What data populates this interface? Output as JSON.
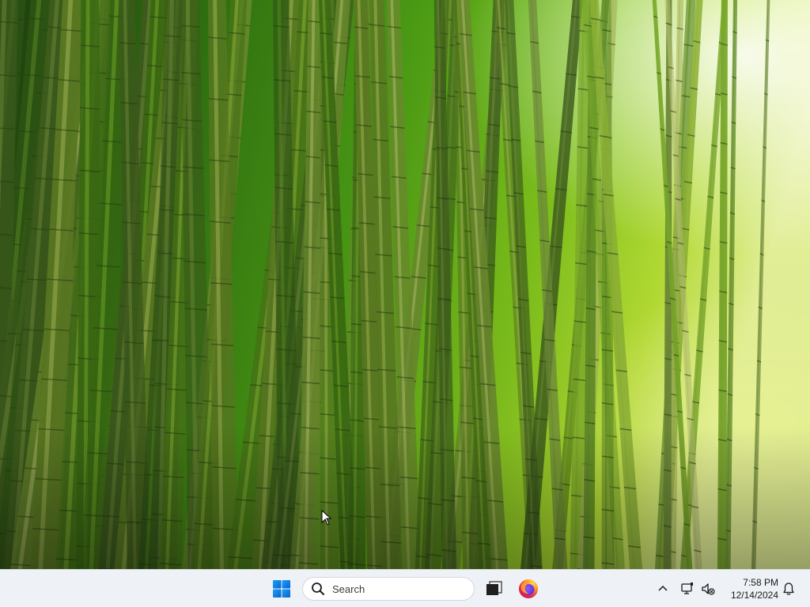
{
  "desktop": {
    "wallpaper_icon": "bamboo-forest-wallpaper"
  },
  "taskbar": {
    "start_icon": "windows-logo-icon",
    "search": {
      "placeholder": "Search",
      "icon": "search-icon"
    },
    "task_view_icon": "task-view-icon",
    "pinned_apps": [
      {
        "name": "Firefox",
        "icon": "firefox-icon"
      }
    ],
    "tray": {
      "chevron_icon": "chevron-up-icon",
      "network_icon": "network-icon",
      "volume_icon": "volume-muted-icon",
      "time": "7:58 PM",
      "date": "12/14/2024",
      "notification_icon": "bell-icon"
    }
  },
  "colors": {
    "taskbar_bg": "#eef1f5",
    "windows_blue": "#0a78d4",
    "firefox_orange": "#ff7139",
    "firefox_purple": "#7542e5"
  }
}
